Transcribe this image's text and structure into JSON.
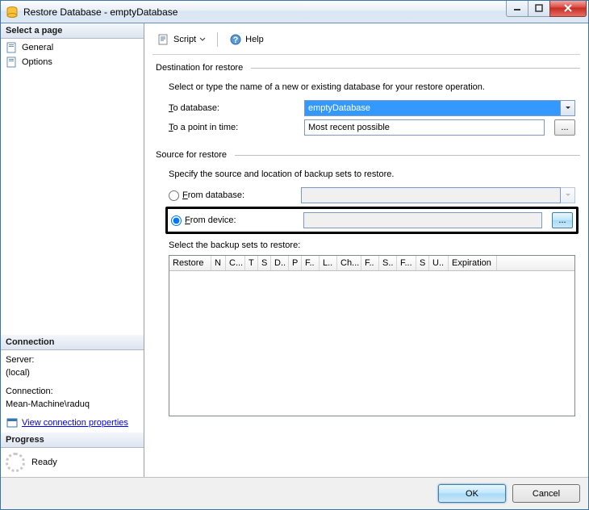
{
  "window": {
    "title": "Restore Database - emptyDatabase"
  },
  "sidebar": {
    "select_page_header": "Select a page",
    "items": [
      {
        "label": "General"
      },
      {
        "label": "Options"
      }
    ],
    "connection_header": "Connection",
    "server_label": "Server:",
    "server_value": "(local)",
    "connection_label": "Connection:",
    "connection_value": "Mean-Machine\\raduq",
    "view_conn_link": "View connection properties",
    "progress_header": "Progress",
    "progress_status": "Ready"
  },
  "toolbar": {
    "script_label": "Script",
    "help_label": "Help"
  },
  "dest": {
    "group_title": "Destination for restore",
    "instruction": "Select or type the name of a new or existing database for your restore operation.",
    "to_db_label_prefix": "T",
    "to_db_label_rest": "o database:",
    "to_db_value": "emptyDatabase",
    "to_point_label_prefix": "T",
    "to_point_label_rest": "o a point in time:",
    "to_point_value": "Most recent possible"
  },
  "source": {
    "group_title": "Source for restore",
    "instruction": "Specify the source and location of backup sets to restore.",
    "from_db_label_prefix": "F",
    "from_db_label_rest": "rom database:",
    "from_db_value": "",
    "from_device_label_prefix": "F",
    "from_device_label_rest": "rom device:",
    "from_device_value": "",
    "backup_sets_label": "Select the backup sets to restore:",
    "columns": [
      "Restore",
      "N",
      "C...",
      "T",
      "S",
      "D..",
      "P",
      "F..",
      "L..",
      "Ch...",
      "F..",
      "S..",
      "F...",
      "S",
      "U..",
      "Expiration"
    ]
  },
  "source_selected": "device",
  "footer": {
    "ok_label": "OK",
    "cancel_label": "Cancel"
  }
}
